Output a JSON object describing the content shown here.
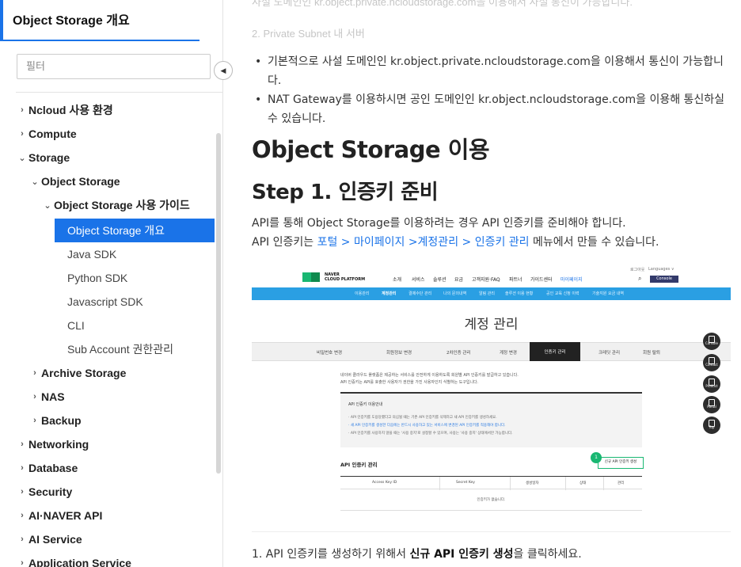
{
  "sidebar": {
    "title": "Object Storage 개요",
    "filter_placeholder": "필터",
    "collapse_glyph": "◀",
    "items": [
      {
        "label": "Ncloud 사용 환경",
        "chev": "›"
      },
      {
        "label": "Compute",
        "chev": "›"
      },
      {
        "label": "Storage",
        "chev": "⌄"
      },
      {
        "label": "Object Storage",
        "chev": "⌄"
      },
      {
        "label": "Object Storage 사용 가이드",
        "chev": "⌄"
      },
      {
        "label": "Object Storage 개요"
      },
      {
        "label": "Java SDK"
      },
      {
        "label": "Python SDK"
      },
      {
        "label": "Javascript SDK"
      },
      {
        "label": "CLI"
      },
      {
        "label": "Sub Account 권한관리"
      },
      {
        "label": "Archive Storage",
        "chev": "›"
      },
      {
        "label": "NAS",
        "chev": "›"
      },
      {
        "label": "Backup",
        "chev": "›"
      },
      {
        "label": "Networking",
        "chev": "›"
      },
      {
        "label": "Database",
        "chev": "›"
      },
      {
        "label": "Security",
        "chev": "›"
      },
      {
        "label": "AI·NAVER API",
        "chev": "›"
      },
      {
        "label": "AI Service",
        "chev": "›"
      },
      {
        "label": "Application Service",
        "chev": "›"
      }
    ]
  },
  "content": {
    "faded_top": "사설 도메인인 kr.object.private.ncloudstorage.com을 이용해서 사설 통신이 가능합니다.",
    "faded_heading": "2. Private Subnet 내 서버",
    "bullets": [
      "기본적으로 사설 도메인인 kr.object.private.ncloudstorage.com을 이용해서 통신이 가능합니다.",
      "NAT Gateway를 이용하시면 공인 도메인인 kr.object.ncloudstorage.com을 이용해 통신하실 수 있습니다."
    ],
    "h1": "Object Storage 이용",
    "h2": "Step 1. 인증키 준비",
    "para1": "API를 통해 Object Storage를 이용하려는 경우 API 인증키를 준비해야 합니다.",
    "para2_pre": "API 인증키는 ",
    "para2_link": "포털 > 마이페이지 >계정관리 > 인증키 관리",
    "para2_post": " 메뉴에서 만들 수 있습니다.",
    "final_pre": "1. API 인증키를 생성하기 위해서 ",
    "final_bold": "신규 API 인증키 생성",
    "final_post": "을 클릭하세요."
  },
  "screenshot": {
    "logo_line1": "NAVER",
    "logo_line2": "CLOUD PLATFORM",
    "gnb": [
      "소개",
      "서비스",
      "솔루션",
      "요금",
      "고객지원·FAQ",
      "파트너",
      "가이드센터",
      "마이페이지"
    ],
    "util_login": "로그아웃",
    "util_lang": "Languages ∨",
    "search_glyph": "⌕",
    "console": "Console",
    "subnav": [
      "이용관리",
      "계정관리",
      "결제수단 관리",
      "나의 문의내역",
      "알림 관리",
      "솔루션 이용 현황",
      "공인 교육 신청 이력",
      "기술지원 요금 내역"
    ],
    "title": "계정 관리",
    "tabs": [
      "비밀번호 변경",
      "회원정보 변경",
      "2차인증 관리",
      "계정 변경",
      "인증키 관리",
      "크레딧 관리",
      "회원 탈퇴"
    ],
    "intro1": "네이버 클라우드 플랫폼은 제공하는 서비스를 안전하게 이용하도록 회원별 API 인증키를 발급하고 있습니다.",
    "intro2": "API 인증키는 API를 호출한 사용자가 권한을 가진 사용자인지 식별하는 도구입니다.",
    "info_title": "API 인증키 이용안내",
    "info_lines": [
      "· API 인증키를 도용당했다고 의심될 때는 기존 API 인증키를 삭제하고 새 API 인증키를 생성하세요.",
      "· 새 API 인증키를 생성한 다음에는 반드시 사용하고 있는 서비스에 변경된 API 인증키를 적용해야 합니다.",
      "· API 인증키를 사용하지 않을 때는 '사용 중지'로 설정할 수 있으며, 사용는 '사용 중지' 상태에서만 가능합니다."
    ],
    "api_heading": "API 인증키 관리",
    "badge": "1",
    "new_button": "신규 API 인증키 생성",
    "columns": [
      "Access Key ID",
      "Secret Key",
      "생성일자",
      "상태",
      "관리"
    ],
    "empty_row": "인증키가 없습니다.",
    "floaters": [
      "Console",
      "Contact",
      "Product",
      "Portal",
      "Top"
    ]
  }
}
